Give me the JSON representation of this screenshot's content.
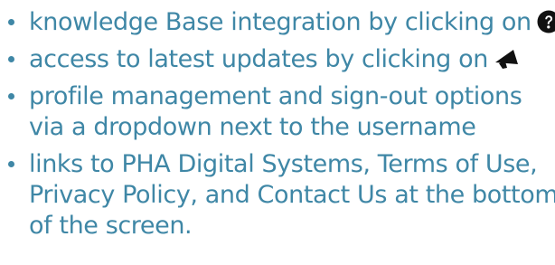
{
  "colors": {
    "text": "#3f87a6",
    "icon": "#111111"
  },
  "items": [
    {
      "lines": [
        "knowledge Base integration by clicking on"
      ],
      "icon": "question-circle-icon"
    },
    {
      "lines": [
        "access to latest updates by clicking on"
      ],
      "icon": "megaphone-icon"
    },
    {
      "lines": [
        "profile management and sign-out options",
        "via a dropdown next to the username"
      ]
    },
    {
      "lines": [
        "links to PHA Digital Systems, Terms of Use,",
        "Privacy Policy, and Contact Us at the bottom",
        "of the screen."
      ]
    }
  ]
}
